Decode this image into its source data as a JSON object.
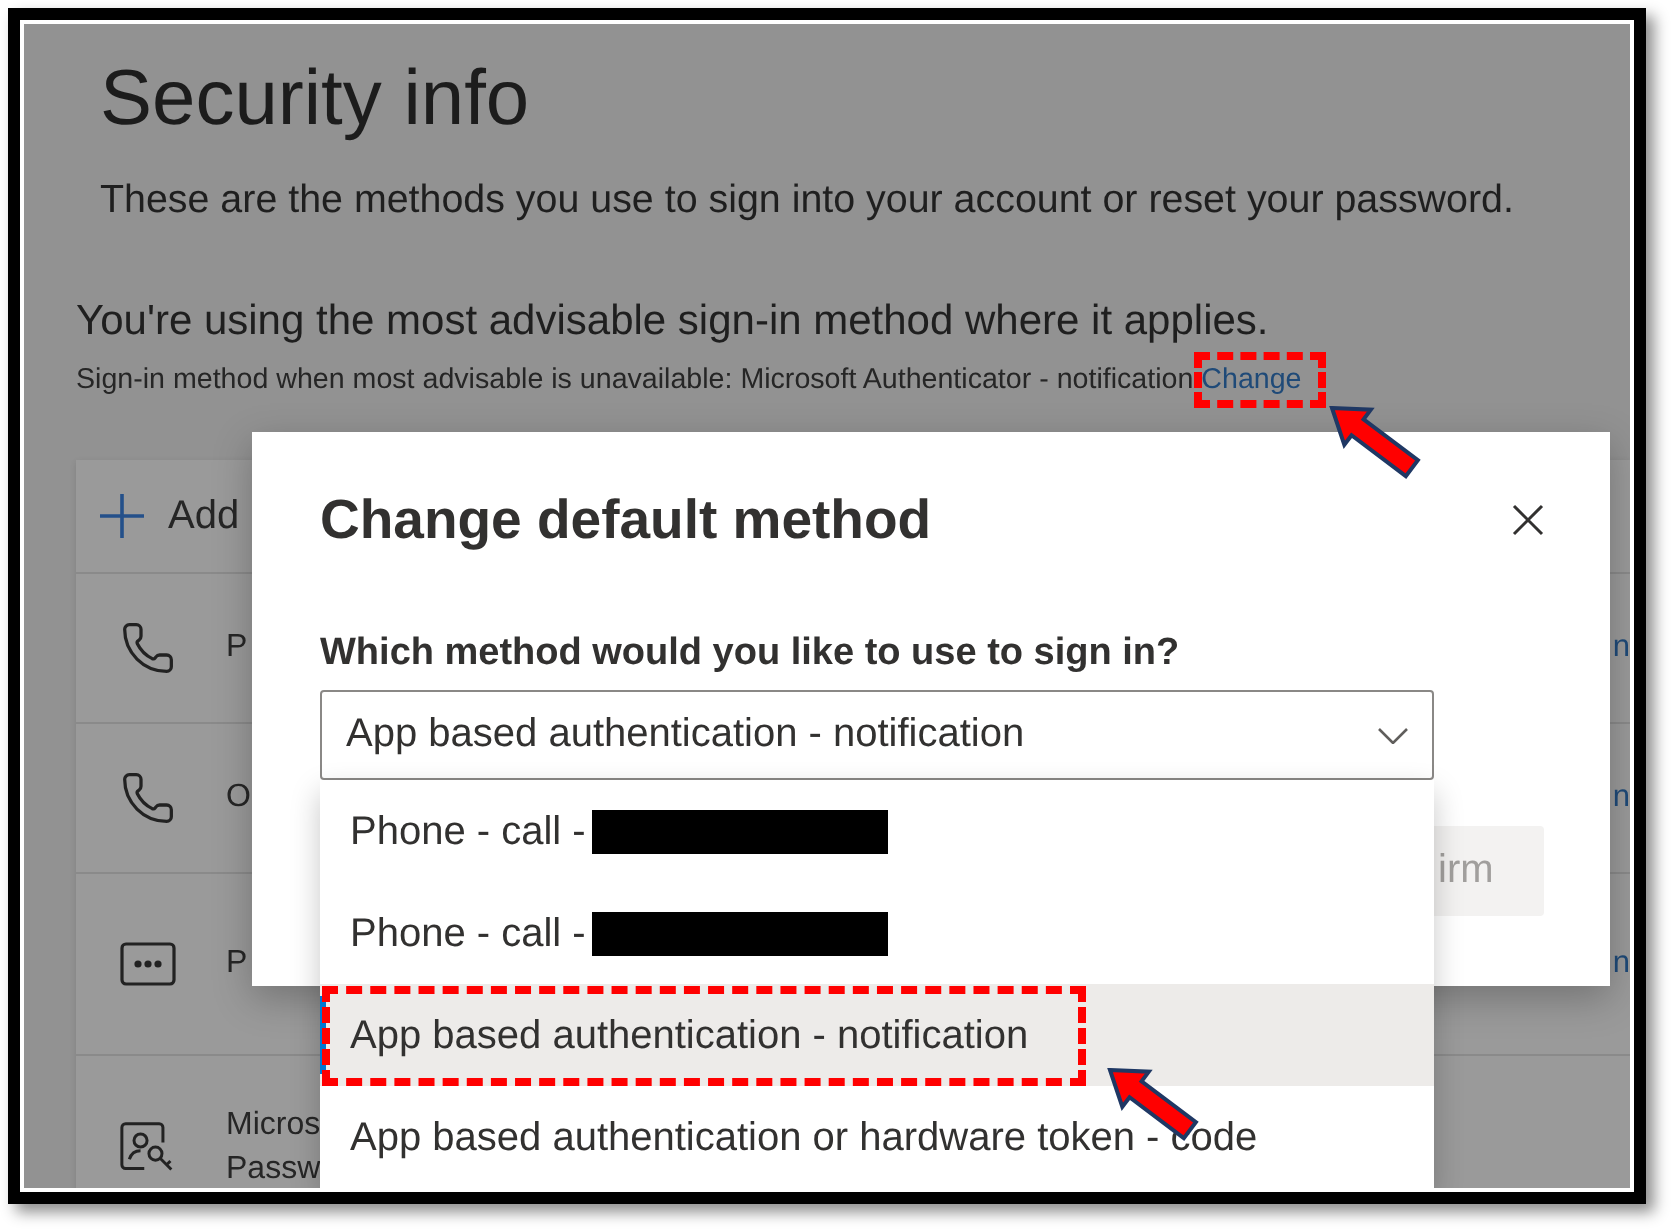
{
  "page": {
    "title": "Security info",
    "subtitle": "These are the methods you use to sign into your account or reset your password.",
    "status": "You're using the most advisable sign-in method where it applies.",
    "fallback": {
      "text": "Sign-in method when most advisable is unavailable: Microsoft Authenticator - notification",
      "link": "Change",
      "link_highlighted": true
    }
  },
  "methods": {
    "add_label": "Add",
    "rows": [
      {
        "kind": "phone",
        "lines": [
          "P"
        ],
        "column_2": "n"
      },
      {
        "kind": "phone",
        "lines": [
          "O"
        ],
        "column_2": "n"
      },
      {
        "kind": "password",
        "lines": [
          "P"
        ],
        "column_2": "n"
      },
      {
        "kind": "key",
        "lines": [
          "Micros",
          "Passw"
        ]
      }
    ]
  },
  "dialog": {
    "title": "Change default method",
    "question": "Which method would you like to use to sign in?",
    "select": {
      "value": "App based authentication - notification",
      "expanded": true
    },
    "options": [
      {
        "label": "Phone - call -",
        "redacted": true,
        "selected": false,
        "highlighted": false
      },
      {
        "label": "Phone - call -",
        "redacted": true,
        "selected": false,
        "highlighted": false
      },
      {
        "label": "App based authentication - notification",
        "redacted": false,
        "selected": true,
        "highlighted": true
      },
      {
        "label": "App based authentication or hardware token - code",
        "redacted": false,
        "selected": false,
        "highlighted": false
      }
    ],
    "confirm": {
      "label": "irm",
      "disabled": true
    }
  }
}
